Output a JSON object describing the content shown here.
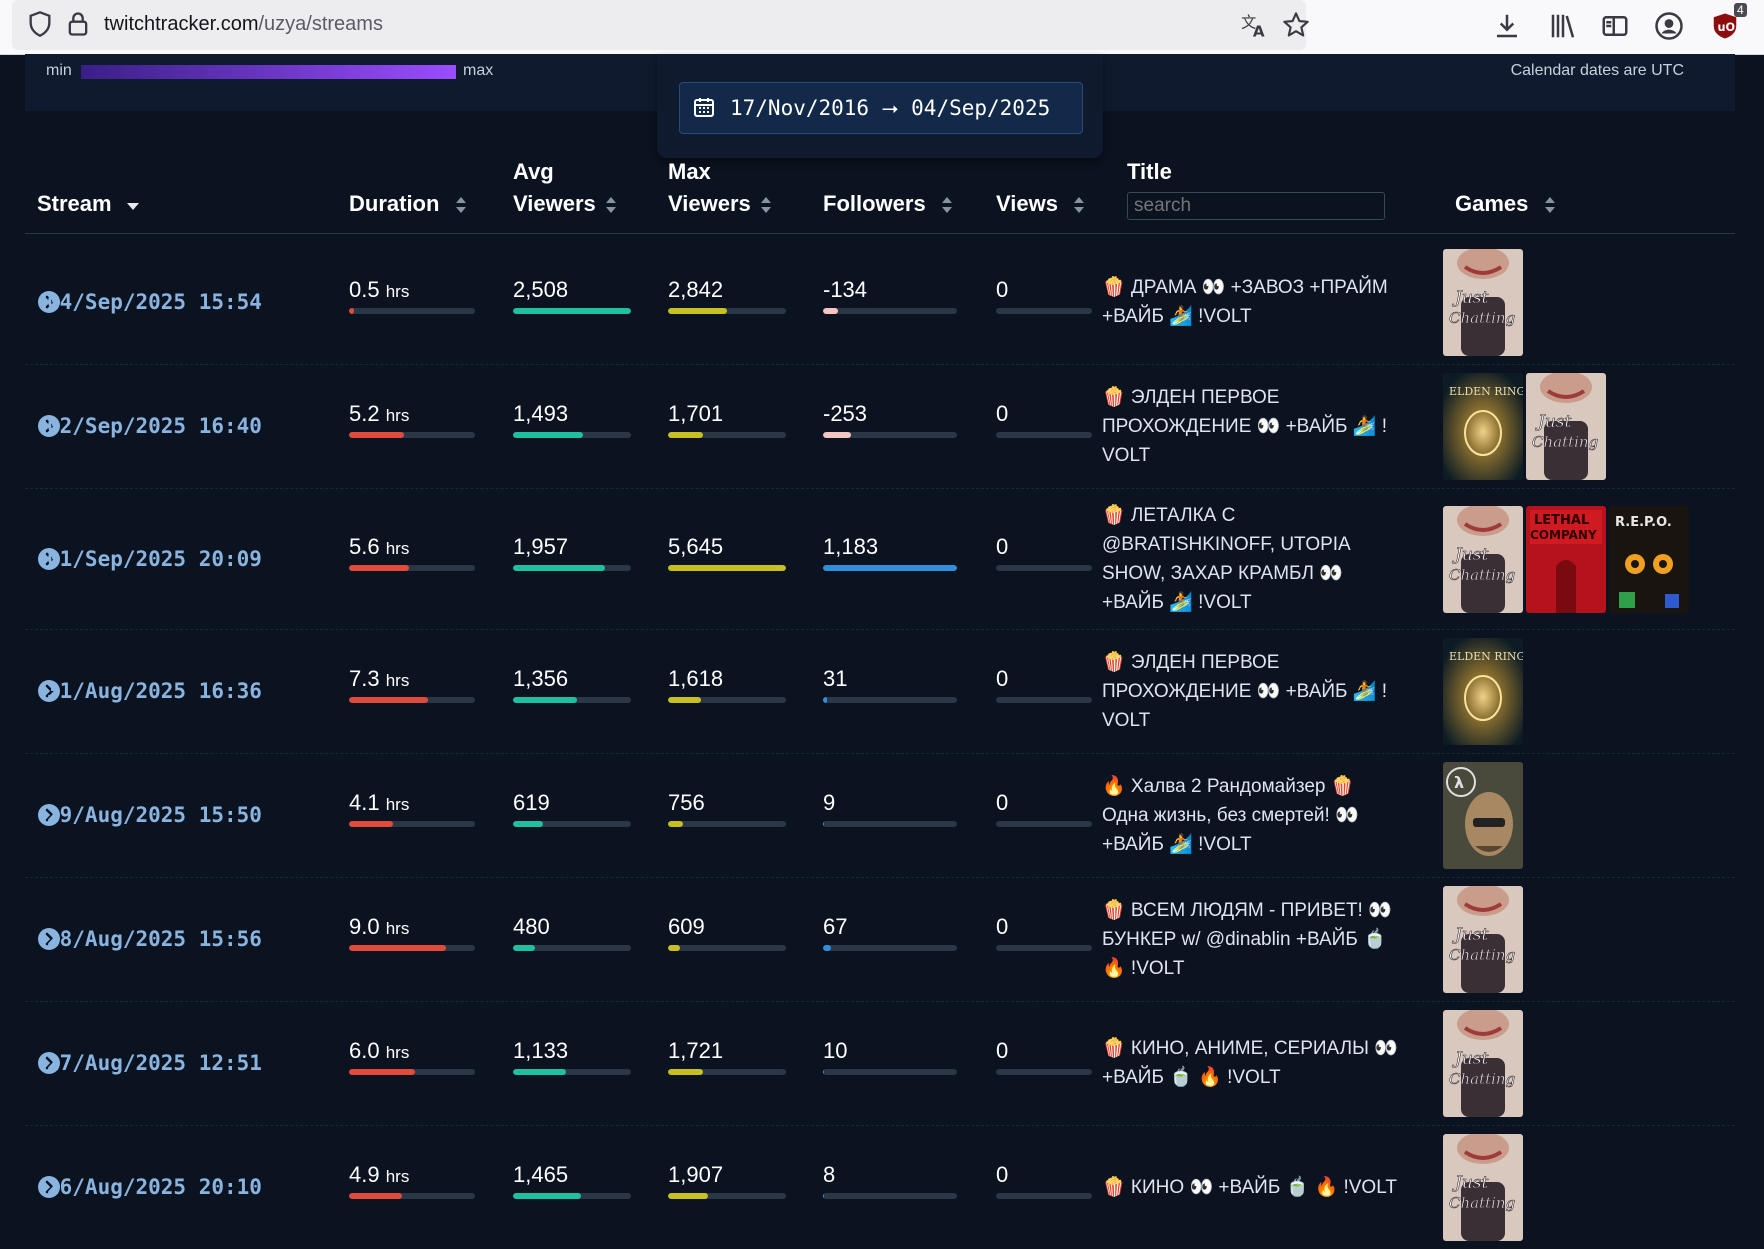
{
  "browser": {
    "url_host": "twitchtracker.com",
    "url_path": "/uzya/streams",
    "extension_badge": "4"
  },
  "legend": {
    "min": "min",
    "max": "max"
  },
  "calendar_note": "Calendar dates are UTC",
  "date_range": {
    "label": "17/Nov/2016 ⭢ 04/Sep/2025"
  },
  "columns": {
    "stream": "Stream",
    "duration": "Duration",
    "avg_viewers_1": "Avg",
    "avg_viewers_2": "Viewers",
    "max_viewers_1": "Max",
    "max_viewers_2": "Viewers",
    "followers": "Followers",
    "views": "Views",
    "title": "Title",
    "title_search_placeholder": "search",
    "games": "Games"
  },
  "unit_hrs": "hrs",
  "colors": {
    "duration": "#e24a3b",
    "avg": "#1fc0a0",
    "max": "#c8c020",
    "followers_pos": "#2f8fdc",
    "followers_neg": "#f3c6c2"
  },
  "rows": [
    {
      "date": "04/Sep/2025 15:54",
      "duration": "0.5",
      "duration_fill": 0.04,
      "avg": "2,508",
      "avg_fill": 1.0,
      "max": "2,842",
      "max_fill": 0.5,
      "followers": "-134",
      "followers_fill": 0.11,
      "followers_neg": true,
      "views": "0",
      "title_lines": [
        "🍿 ДРАМА 👀 +ЗАВОЗ +ПРАЙМ",
        "+ВАЙБ 🏄 !VOLT"
      ],
      "games": [
        "Just Chatting"
      ]
    },
    {
      "date": "02/Sep/2025 16:40",
      "duration": "5.2",
      "duration_fill": 0.44,
      "avg": "1,493",
      "avg_fill": 0.59,
      "max": "1,701",
      "max_fill": 0.3,
      "followers": "-253",
      "followers_fill": 0.21,
      "followers_neg": true,
      "views": "0",
      "title_lines": [
        "🍿 ЭЛДЕН ПЕРВОЕ",
        "ПРОХОЖДЕНИЕ 👀 +ВАЙБ 🏄 !",
        "VOLT"
      ],
      "games": [
        "Elden Ring",
        "Just Chatting"
      ]
    },
    {
      "date": "01/Sep/2025 20:09",
      "duration": "5.6",
      "duration_fill": 0.48,
      "avg": "1,957",
      "avg_fill": 0.78,
      "max": "5,645",
      "max_fill": 1.0,
      "followers": "1,183",
      "followers_fill": 1.0,
      "followers_neg": false,
      "views": "0",
      "title_lines": [
        "🍿 ЛЕТАЛКА С",
        "@BRATISHKINOFF, UTOPIA",
        "SHOW, ЗАХАР КРАМБЛ 👀",
        "+ВАЙБ 🏄 !VOLT"
      ],
      "games": [
        "Just Chatting",
        "Lethal Company",
        "R.E.P.O."
      ]
    },
    {
      "date": "31/Aug/2025 16:36",
      "duration": "7.3",
      "duration_fill": 0.63,
      "avg": "1,356",
      "avg_fill": 0.54,
      "max": "1,618",
      "max_fill": 0.28,
      "followers": "31",
      "followers_fill": 0.03,
      "followers_neg": false,
      "views": "0",
      "title_lines": [
        "🍿 ЭЛДЕН ПЕРВОЕ",
        "ПРОХОЖДЕНИЕ 👀 +ВАЙБ 🏄 !",
        "VOLT"
      ],
      "games": [
        "Elden Ring"
      ]
    },
    {
      "date": "29/Aug/2025 15:50",
      "duration": "4.1",
      "duration_fill": 0.35,
      "avg": "619",
      "avg_fill": 0.25,
      "max": "756",
      "max_fill": 0.13,
      "followers": "9",
      "followers_fill": 0.01,
      "followers_neg": false,
      "views": "0",
      "title_lines": [
        "🔥 Халва 2 Рандомайзер 🍿",
        "Одна жизнь, без смертей! 👀",
        "+ВАЙБ 🏄 !VOLT"
      ],
      "games": [
        "Half-Life 2"
      ]
    },
    {
      "date": "28/Aug/2025 15:56",
      "duration": "9.0",
      "duration_fill": 0.77,
      "avg": "480",
      "avg_fill": 0.19,
      "max": "609",
      "max_fill": 0.1,
      "followers": "67",
      "followers_fill": 0.06,
      "followers_neg": false,
      "views": "0",
      "title_lines": [
        "🍿 ВСЕМ ЛЮДЯМ - ПРИВЕТ! 👀",
        "БУНКЕР w/ @dinablin +ВАЙБ 🍵",
        "🔥 !VOLT"
      ],
      "games": [
        "Just Chatting"
      ]
    },
    {
      "date": "27/Aug/2025 12:51",
      "duration": "6.0",
      "duration_fill": 0.52,
      "avg": "1,133",
      "avg_fill": 0.45,
      "max": "1,721",
      "max_fill": 0.3,
      "followers": "10",
      "followers_fill": 0.01,
      "followers_neg": false,
      "views": "0",
      "title_lines": [
        "🍿 КИНО, АНИМЕ, СЕРИАЛЫ 👀",
        "+ВАЙБ 🍵 🔥 !VOLT"
      ],
      "games": [
        "Just Chatting"
      ]
    },
    {
      "date": "26/Aug/2025 20:10",
      "duration": "4.9",
      "duration_fill": 0.42,
      "avg": "1,465",
      "avg_fill": 0.58,
      "max": "1,907",
      "max_fill": 0.34,
      "followers": "8",
      "followers_fill": 0.01,
      "followers_neg": false,
      "views": "0",
      "title_lines": [
        "🍿 КИНО 👀 +ВАЙБ 🍵 🔥 !VOLT"
      ],
      "games": [
        "Just Chatting"
      ]
    }
  ]
}
